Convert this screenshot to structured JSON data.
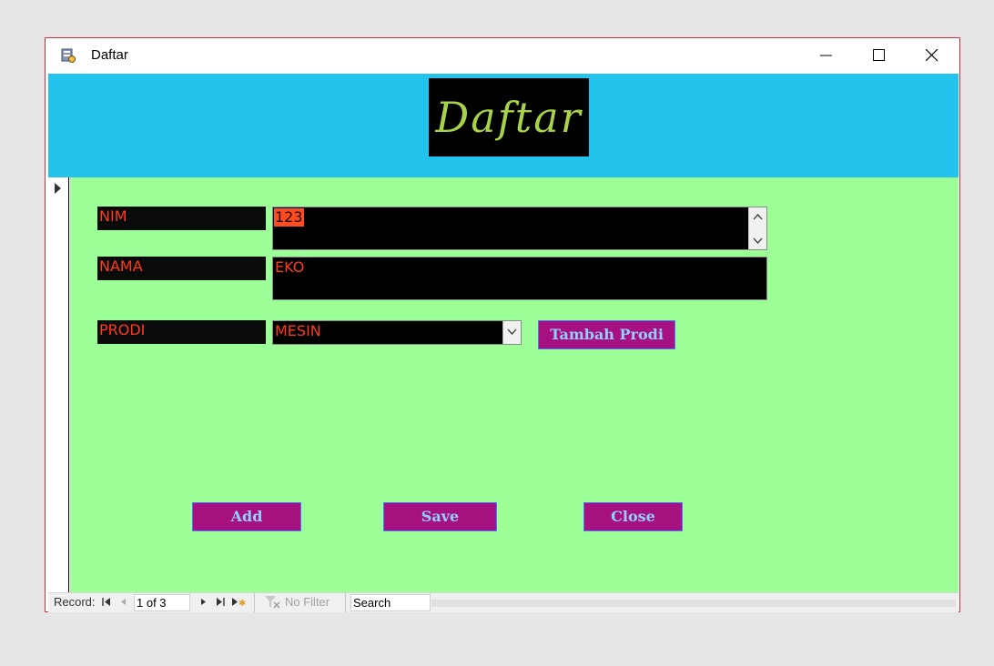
{
  "window": {
    "title": "Daftar",
    "icon": "access-form-icon",
    "controls": [
      "minimize-icon",
      "maximize-icon",
      "close-icon"
    ]
  },
  "header": {
    "logo_text": "Daftar"
  },
  "form": {
    "nim": {
      "label": "NIM",
      "value": "123"
    },
    "nama": {
      "label": "NAMA",
      "value": "EKO"
    },
    "prodi": {
      "label": "PRODI",
      "value": "MESIN"
    },
    "tambah_prodi_label": "Tambah Prodi"
  },
  "buttons": {
    "add": "Add",
    "save": "Save",
    "close": "Close"
  },
  "navigation": {
    "record_label": "Record:",
    "record_position": "1 of 3",
    "filter_label": "No Filter",
    "search_label": "Search"
  },
  "colors": {
    "header_bg": "#22c4ee",
    "detail_bg": "#9dff97",
    "label_text": "#ff3a1f",
    "button_bg": "#a6117f",
    "button_text": "#8fd0ff",
    "logo_text": "#a8d248"
  }
}
